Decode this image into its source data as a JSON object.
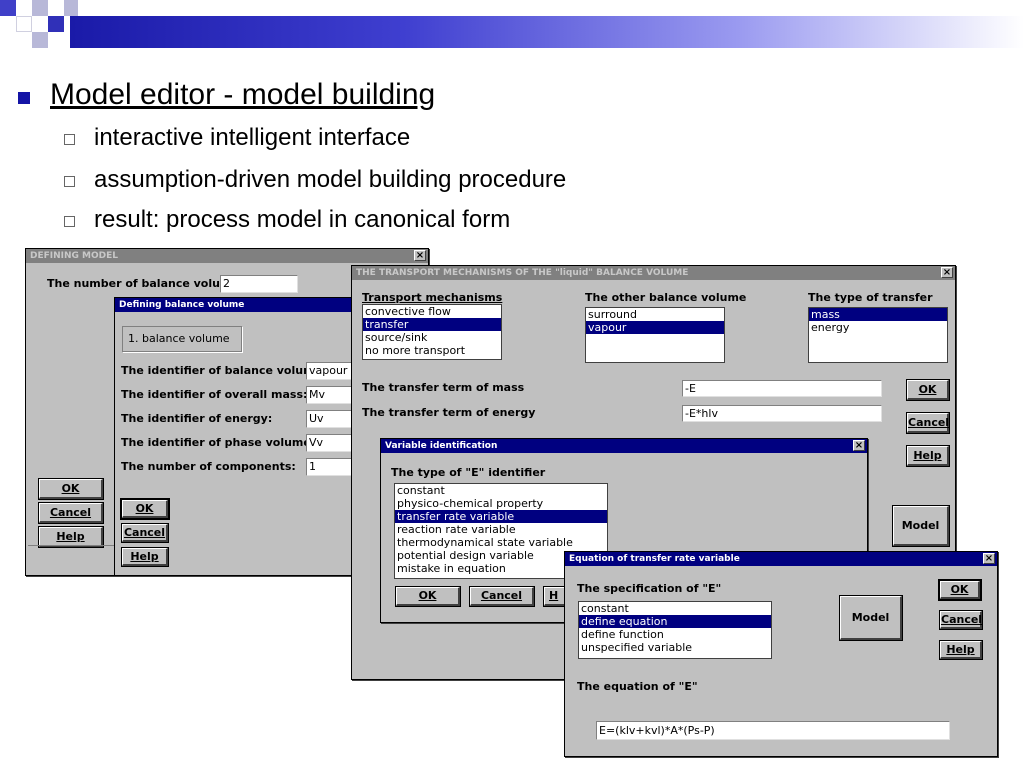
{
  "slide": {
    "title": "Model editor - model building",
    "bullets": [
      "interactive intelligent interface",
      "assumption-driven model building procedure",
      "result: process model in canonical form"
    ]
  },
  "defining_model": {
    "title": "DEFINING MODEL",
    "close": "×",
    "number_label": "The number of balance volumes",
    "number_value": "2",
    "ok": "OK",
    "cancel": "Cancel",
    "help": "Help"
  },
  "balance_volume": {
    "title": "Defining balance volume",
    "group_label": "1. balance volume",
    "rows": [
      {
        "label": "The identifier of balance volume:",
        "value": "vapour"
      },
      {
        "label": "The identifier of overall mass:",
        "value": "Mv"
      },
      {
        "label": "The identifier of energy:",
        "value": "Uv"
      },
      {
        "label": "The identifier of phase volume:",
        "value": "Vv"
      },
      {
        "label": "The number of components:",
        "value": "1"
      }
    ],
    "ok": "OK",
    "cancel": "Cancel",
    "help": "Help"
  },
  "transport": {
    "title": "THE TRANSPORT MECHANISMS OF THE \"liquid\" BALANCE VOLUME",
    "close": "×",
    "mechanisms_label": "Transport mechanisms",
    "mechanisms": [
      "convective flow",
      "transfer",
      "source/sink",
      "no more transport"
    ],
    "mechanisms_selected": 1,
    "other_volume_label": "The other balance volume",
    "other_volumes": [
      "surround",
      "vapour"
    ],
    "other_selected": 1,
    "transfer_type_label": "The type of transfer",
    "transfer_types": [
      "mass",
      "energy"
    ],
    "transfer_selected": 0,
    "mass_term_label": "The transfer term of mass",
    "mass_term_value": "-E",
    "energy_term_label": "The transfer term of energy",
    "energy_term_value": "-E*hlv",
    "ok": "OK",
    "cancel": "Cancel",
    "help": "Help",
    "model": "Model"
  },
  "variable_id": {
    "title": "Variable identification",
    "close": "×",
    "type_label": "The type of \"E\" identifier",
    "types": [
      "constant",
      "physico-chemical property",
      "transfer rate variable",
      "reaction rate variable",
      "thermodynamical state variable",
      "potential design variable",
      "mistake in equation"
    ],
    "types_selected": 2,
    "ok": "OK",
    "cancel": "Cancel",
    "help_partial": "H"
  },
  "equation": {
    "title": "Equation of transfer rate variable",
    "close": "×",
    "spec_label": "The specification of \"E\"",
    "specs": [
      "constant",
      "define equation",
      "define function",
      "unspecified variable"
    ],
    "specs_selected": 1,
    "model": "Model",
    "ok": "OK",
    "cancel": "Cancel",
    "help": "Help",
    "equation_label": "The equation of \"E\"",
    "equation_value": "E=(klv+kvl)*A*(Ps-P)"
  },
  "colors": {
    "header_dark": "#1a1aa8",
    "square_blue": "#4040c8",
    "square_gray": "#b8b8d8",
    "dialog_gray": "#c0c0c0",
    "title_active": "#000080",
    "title_inactive": "#808080"
  }
}
